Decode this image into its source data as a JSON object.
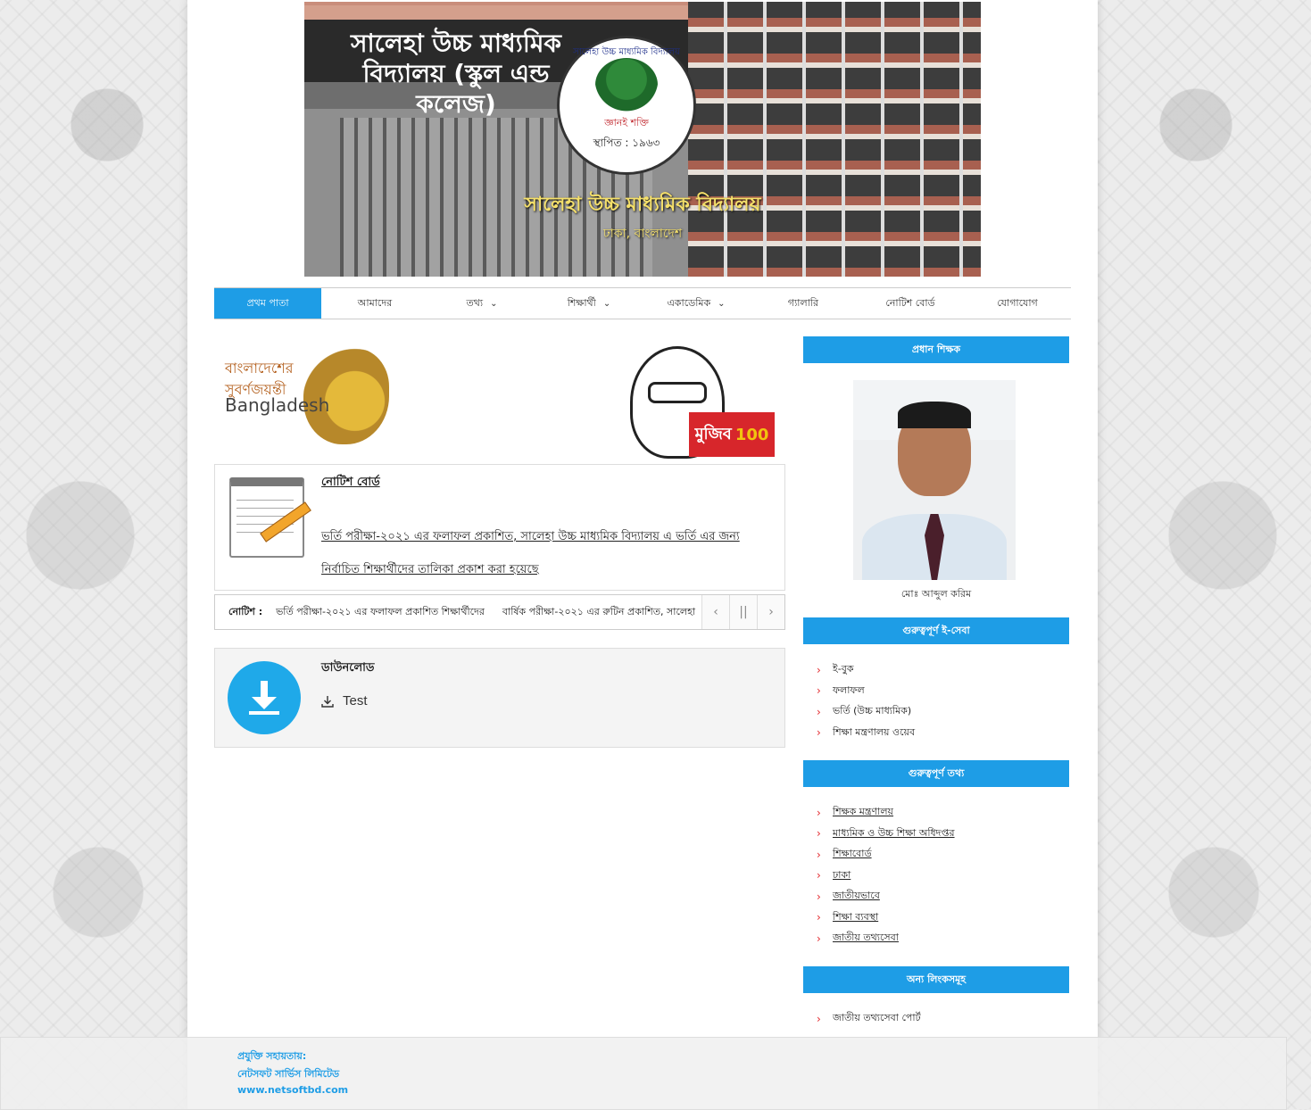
{
  "banner": {
    "sign": "সালেহা উচ্চ মাধ্যমিক বিদ্যালয় (স্কুল এন্ড কলেজ)",
    "seal_ring": "সালেহা উচ্চ মাধ্যমিক বিদ্যালয়",
    "seal_motto": "জ্ঞানই শক্তি",
    "seal_year": "স্থাপিত : ১৯৬৩",
    "title": "সালেহা উচ্চ মাধ্যমিক বিদ্যালয়",
    "subtitle": "ঢাকা, বাংলাদেশ"
  },
  "nav": {
    "items": [
      {
        "label": "প্রথম পাতা",
        "active": true,
        "dropdown": false
      },
      {
        "label": "আমাদের",
        "active": false,
        "dropdown": false
      },
      {
        "label": "তথ্য",
        "active": false,
        "dropdown": true
      },
      {
        "label": "শিক্ষার্থী",
        "active": false,
        "dropdown": true
      },
      {
        "label": "একাডেমিক",
        "active": false,
        "dropdown": true
      },
      {
        "label": "গ্যালারি",
        "active": false,
        "dropdown": false
      },
      {
        "label": "নোটিশ বোর্ড",
        "active": false,
        "dropdown": false
      },
      {
        "label": "যোগাযোগ",
        "active": false,
        "dropdown": false
      }
    ]
  },
  "promo": {
    "bd50_line1": "বাংলাদেশের",
    "bd50_line2": "সুবর্ণজয়ন্তী",
    "bd50_line3": "Bangladesh",
    "mujib_badge": "মুজিব",
    "mujib_year": "100"
  },
  "notice": {
    "title": "নোটিশ বোর্ড",
    "text": "ভর্তি পরীক্ষা-২০২১ এর ফলাফল প্রকাশিত, সালেহা উচ্চ মাধ্যমিক বিদ্যালয় এ ভর্তি এর জন্য নির্বাচিত শিক্ষার্থীদের তালিকা প্রকাশ করা হয়েছে"
  },
  "ticker": {
    "label": "নোটিশ :",
    "items": [
      "ভর্তি পরীক্ষা-২০২১ এর ফলাফল প্রকাশিত শিক্ষার্থীদের",
      "বার্ষিক পরীক্ষা-২০২১ এর রুটিন প্রকাশিত, সালেহা"
    ],
    "prev": "‹",
    "pause": "||",
    "next": "›"
  },
  "download": {
    "title": "ডাউনলোড",
    "items": [
      "Test"
    ]
  },
  "sidebar": {
    "head_title": "প্রধান শিক্ষক",
    "head_name": "মোঃ আব্দুল করিম",
    "eservice_title": "গুরুত্বপূর্ণ ই-সেবা",
    "eservice_items": [
      "ই-বুক",
      "ফলাফল",
      "ভর্তি (উচ্চ মাধ্যমিক)",
      "শিক্ষা মন্ত্রণালয় ওয়েব"
    ],
    "links_title": "গুরুত্বপূর্ণ তথ্য",
    "links_items": [
      "শিক্ষক মন্ত্রণালয়",
      "মাধ্যমিক ও উচ্চ শিক্ষা অধিদপ্তর",
      "শিক্ষাবোর্ড",
      "ঢাকা",
      "জাতীয়ভাবে",
      "শিক্ষা ব্যবস্থা",
      "জাতীয় তথ্যসেবা"
    ],
    "other_title": "অন্য লিংকসমূহ",
    "other_items": [
      "জাতীয় তথ্যসেবা পোর্ট"
    ]
  },
  "footer": {
    "line1": "প্রযুক্তি সহায়তায়:",
    "line2": "নেটসফট সার্ভিস লিমিটেড",
    "line3": "www.netsoftbd.com"
  },
  "colors": {
    "accent": "#1e9de6",
    "arrow": "#e3262b",
    "banner_text": "#f5e06a"
  }
}
